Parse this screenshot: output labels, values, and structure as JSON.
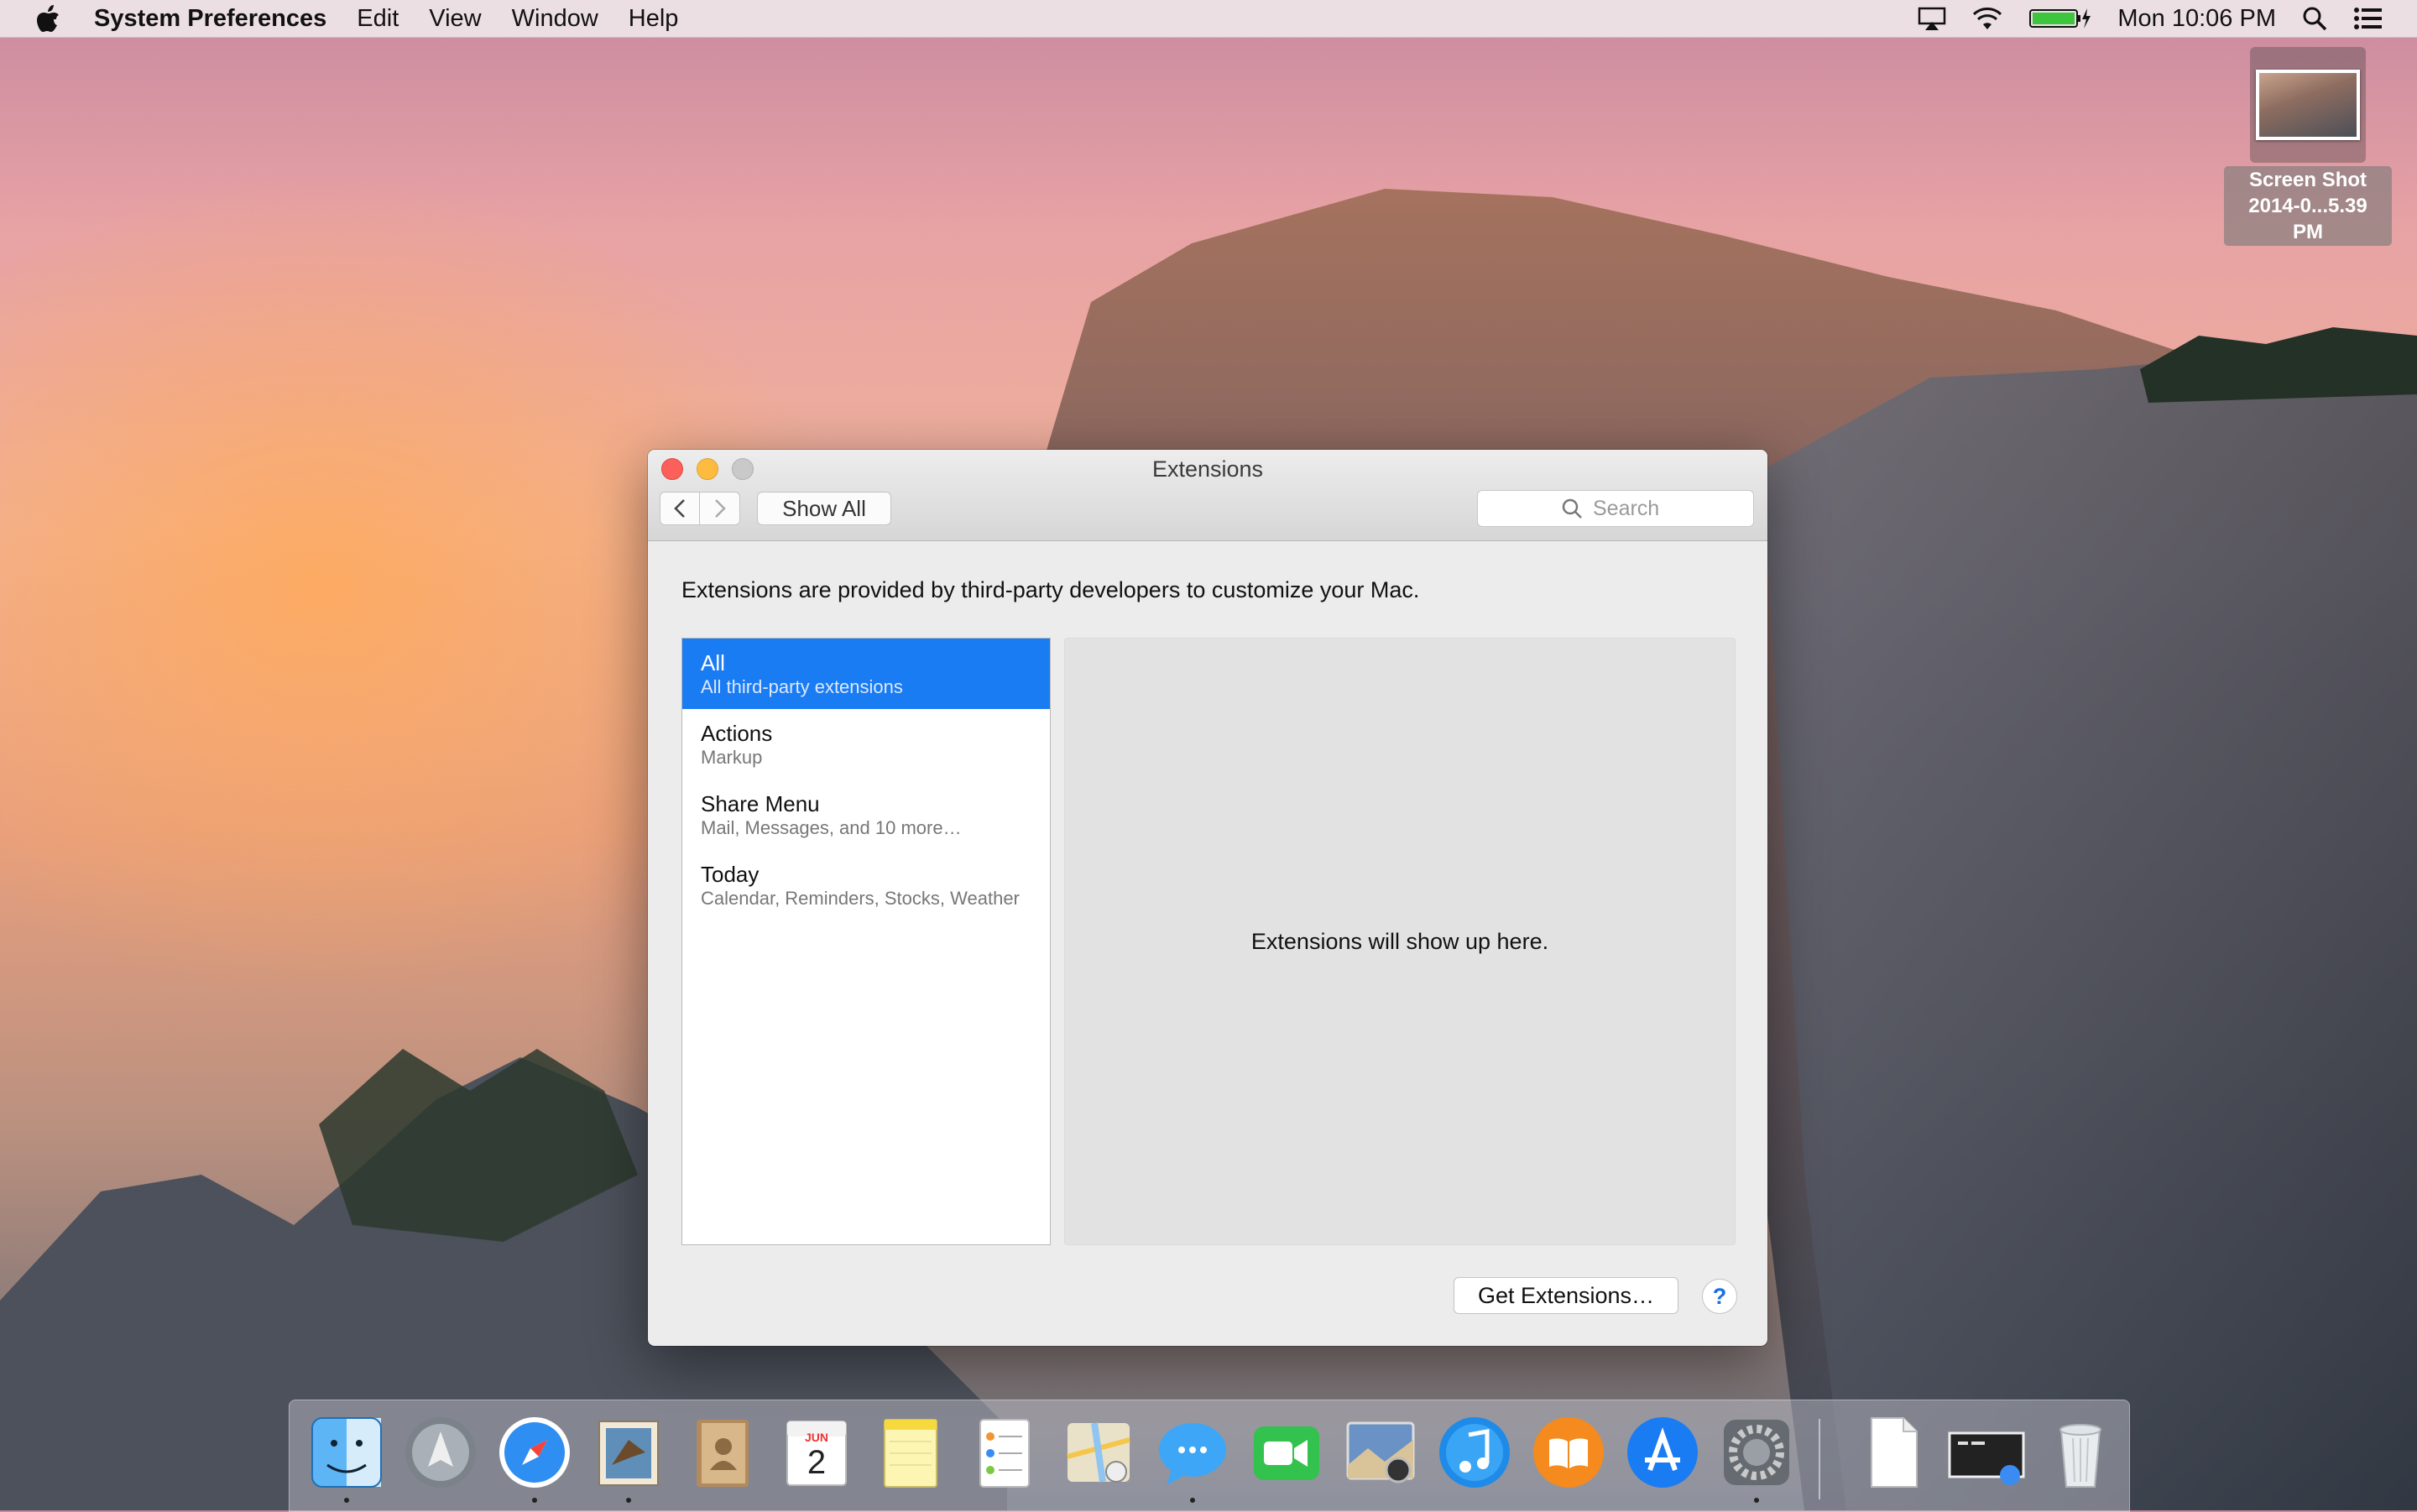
{
  "menubar": {
    "app_name": "System Preferences",
    "menus": [
      "Edit",
      "View",
      "Window",
      "Help"
    ],
    "clock": "Mon 10:06 PM",
    "status_icons": [
      "airplay-icon",
      "wifi-icon",
      "battery-icon",
      "spotlight-icon",
      "notification-center-icon"
    ]
  },
  "desktop_file": {
    "name_line1": "Screen Shot",
    "name_line2": "2014-0...5.39 PM"
  },
  "window": {
    "title": "Extensions",
    "show_all": "Show All",
    "search_placeholder": "Search",
    "intro": "Extensions are provided by third-party developers to customize your Mac.",
    "categories": [
      {
        "name": "All",
        "desc": "All third-party extensions",
        "selected": true
      },
      {
        "name": "Actions",
        "desc": "Markup"
      },
      {
        "name": "Share Menu",
        "desc": "Mail, Messages, and 10 more…"
      },
      {
        "name": "Today",
        "desc": "Calendar, Reminders, Stocks, Weather"
      }
    ],
    "detail_message": "Extensions will show up here.",
    "get_extensions": "Get Extensions…",
    "help": "?"
  },
  "dock": {
    "apps": [
      "Finder",
      "Launchpad",
      "Safari",
      "Mail",
      "Contacts",
      "Calendar",
      "Notes",
      "Reminders",
      "Maps",
      "Messages",
      "FaceTime",
      "Photo Booth",
      "iTunes",
      "iBooks",
      "App Store",
      "System Preferences"
    ],
    "calendar_month": "JUN",
    "calendar_day": "2",
    "right_items": [
      "Document",
      "Screen Shot",
      "Trash"
    ]
  },
  "colors": {
    "accent": "#1a7cf3",
    "close": "#fc605b",
    "minimize": "#fdbc40"
  }
}
